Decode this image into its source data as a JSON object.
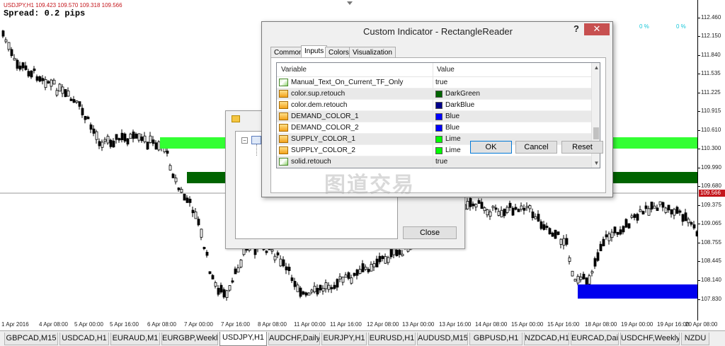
{
  "chart": {
    "symbol_info": "USDJPY,H1  109.423 109.570 109.318 109.566",
    "spread_text": "Spread: 0.2 pips",
    "pct_labels": [
      "0 %",
      "0 %"
    ],
    "current_price": "109.566",
    "price_labels": [
      "112.460",
      "112.150",
      "111.840",
      "111.535",
      "111.225",
      "110.915",
      "110.610",
      "110.300",
      "109.990",
      "109.680",
      "109.375",
      "109.065",
      "108.755",
      "108.445",
      "108.140",
      "107.830"
    ],
    "time_labels": [
      "1 Apr 2016",
      "4 Apr 08:00",
      "5 Apr 00:00",
      "5 Apr 16:00",
      "6 Apr 08:00",
      "7 Apr 00:00",
      "7 Apr 16:00",
      "8 Apr 08:00",
      "11 Apr 00:00",
      "11 Apr 16:00",
      "12 Apr 08:00",
      "13 Apr 00:00",
      "13 Apr 16:00",
      "14 Apr 08:00",
      "15 Apr 00:00",
      "15 Apr 16:00",
      "18 Apr 08:00",
      "19 Apr 00:00",
      "19 Apr 16:00",
      "20 Apr 08:00"
    ],
    "colors": {
      "supply": "#33ff33",
      "demand_dark": "#006400",
      "demand_blue": "#0000ee",
      "candle_bull": "#ffffff",
      "candle_bear": "#000000"
    }
  },
  "symbol_tabs": [
    "GBPCAD,M15",
    "USDCAD,H1",
    "EURAUD,M1",
    "EURGBP,Weekly",
    "USDJPY,H1",
    "AUDCHF,Daily",
    "EURJPY,H1",
    "EURUSD,H1",
    "AUDUSD,M15",
    "GBPUSD,H1",
    "NZDCAD,H1",
    "EURCAD,Daily",
    "USDCHF,Weekly",
    "NZDU"
  ],
  "active_tab_index": 4,
  "bg_dialog": {
    "close_label": "Close"
  },
  "dialog": {
    "title": "Custom Indicator - RectangleReader",
    "help_label": "?",
    "close_label": "✕",
    "tabs": [
      "Common",
      "Inputs",
      "Colors",
      "Visualization"
    ],
    "active_tab_index": 1,
    "grid_headers": {
      "variable": "Variable",
      "value": "Value"
    },
    "rows": [
      {
        "name": "Manual_Text_On_Current_TF_Only",
        "value": "true",
        "icon": "green",
        "color": ""
      },
      {
        "name": "color.sup.retouch",
        "value": "DarkGreen",
        "icon": "orange",
        "color": "#006400"
      },
      {
        "name": "color.dem.retouch",
        "value": "DarkBlue",
        "icon": "orange",
        "color": "#00008b"
      },
      {
        "name": "DEMAND_COLOR_1",
        "value": "Blue",
        "icon": "orange",
        "color": "#0000ff"
      },
      {
        "name": "DEMAND_COLOR_2",
        "value": "Blue",
        "icon": "orange",
        "color": "#0000ff"
      },
      {
        "name": "SUPPLY_COLOR_1",
        "value": "Lime",
        "icon": "orange",
        "color": "#00ff00"
      },
      {
        "name": "SUPPLY_COLOR_2",
        "value": "Lime",
        "icon": "orange",
        "color": "#00ff00"
      },
      {
        "name": "solid.retouch",
        "value": "true",
        "icon": "green",
        "color": ""
      }
    ],
    "buttons": {
      "ok": "OK",
      "cancel": "Cancel",
      "reset": "Reset"
    }
  },
  "watermark": "图道交易"
}
